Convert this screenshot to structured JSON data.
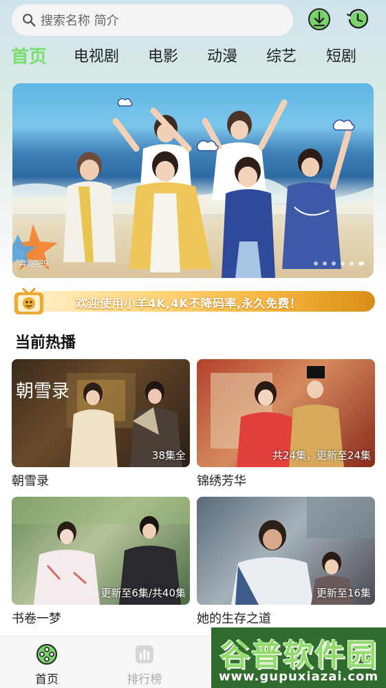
{
  "search": {
    "placeholder": "搜索名称 简介"
  },
  "header_icons": {
    "download": "download-icon",
    "history": "history-clock-icon",
    "accent": "#7ad36b"
  },
  "tabs": [
    {
      "label": "首页",
      "active": true
    },
    {
      "label": "电视剧",
      "active": false
    },
    {
      "label": "电影",
      "active": false
    },
    {
      "label": "动漫",
      "active": false
    },
    {
      "label": "综艺",
      "active": false
    },
    {
      "label": "短剧",
      "active": false
    }
  ],
  "banner": {
    "caption": "奔跑吧9",
    "slide_count": 6,
    "current_slide": 1
  },
  "notice": {
    "text": "欢迎使用小羊4K,4K不降码率,永久免费！"
  },
  "section": {
    "title": "当前热播"
  },
  "cards": [
    {
      "title": "朝雪录",
      "badge": "38集全",
      "poster_text": "朝雪录"
    },
    {
      "title": "锦绣芳华",
      "badge": "共24集，更新至24集"
    },
    {
      "title": "书卷一梦",
      "badge": "更新至6集/共40集"
    },
    {
      "title": "她的生存之道",
      "badge": "更新至16集"
    }
  ],
  "bottom_nav": [
    {
      "label": "首页",
      "active": true,
      "icon": "film-reel-icon"
    },
    {
      "label": "排行榜",
      "active": false,
      "icon": "ranking-chart-icon"
    }
  ],
  "watermark": {
    "title": "谷普软件园",
    "url": "www.gupuxiazai.com"
  }
}
